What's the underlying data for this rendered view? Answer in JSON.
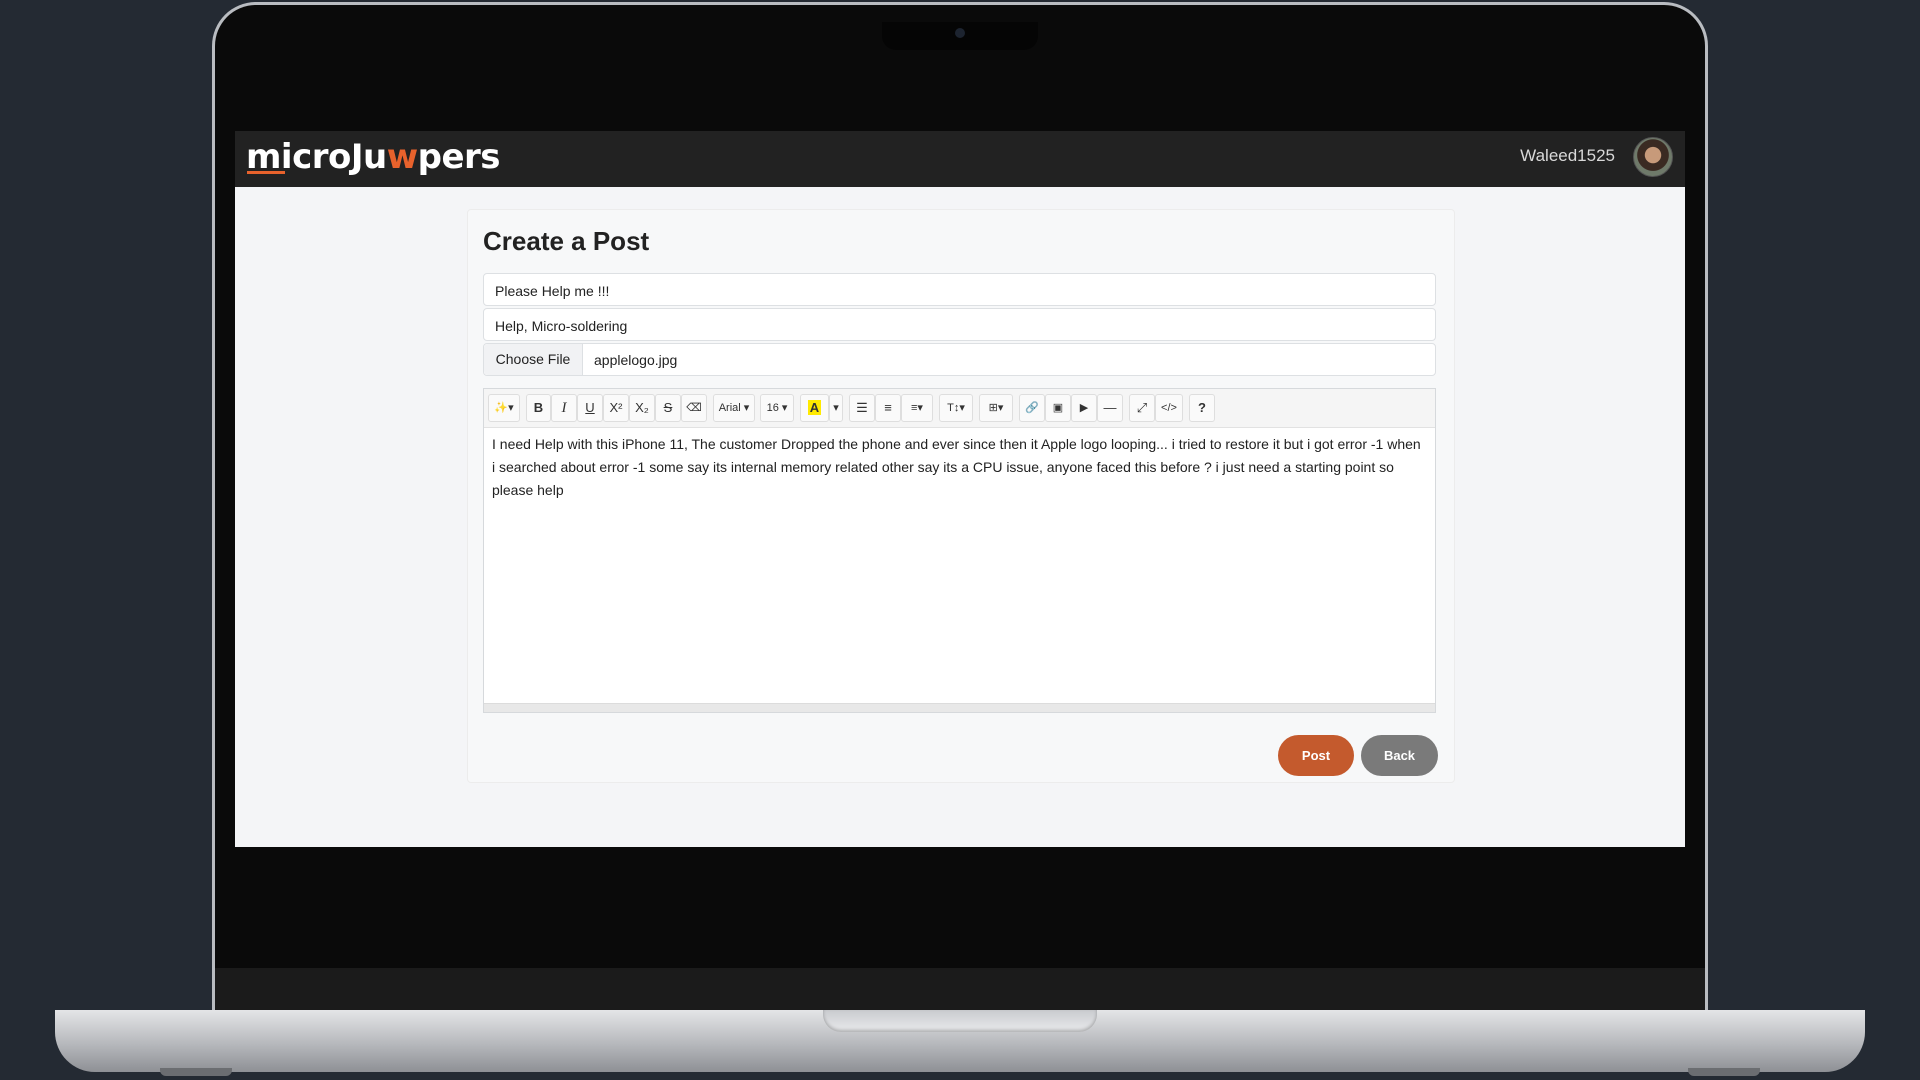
{
  "header": {
    "logo_text_a": "microJu",
    "logo_text_w": "w",
    "logo_text_b": "pers",
    "username": "Waleed1525"
  },
  "page": {
    "title": "Create a Post"
  },
  "form": {
    "title_value": "Please Help me !!!",
    "tags_value": "Help, Micro-soldering",
    "file_button_label": "Choose File",
    "file_name": "applelogo.jpg",
    "body_text": "I need Help with this iPhone 11, The customer Dropped the phone and ever since then it Apple logo looping... i tried to restore it but i got error -1 when i searched about error -1 some say its internal memory related other say its a CPU issue, anyone faced this before ? i just need a starting point so please help",
    "post_label": "Post",
    "back_label": "Back"
  },
  "toolbar": {
    "magic_icon": "✨▾",
    "bold": "B",
    "italic": "I",
    "underline": "U",
    "superscript": "X²",
    "subscript": "X₂",
    "strike": "S",
    "eraser": "⌫",
    "font_name": "Arial ▾",
    "font_size": "16 ▾",
    "color": "A",
    "color_caret": "▾",
    "ul": "☰",
    "ol": "≡",
    "align": "≡▾",
    "line_height": "T↕▾",
    "table": "⊞▾",
    "link": "🔗",
    "image": "▣",
    "video": "▶",
    "hr": "—",
    "fullscreen": "⤢",
    "code": "</>",
    "help": "?"
  },
  "colors": {
    "accent": "#c45a2d",
    "logo_accent": "#e8622c",
    "navbar": "#222222",
    "back_button": "#7a7a7a"
  }
}
